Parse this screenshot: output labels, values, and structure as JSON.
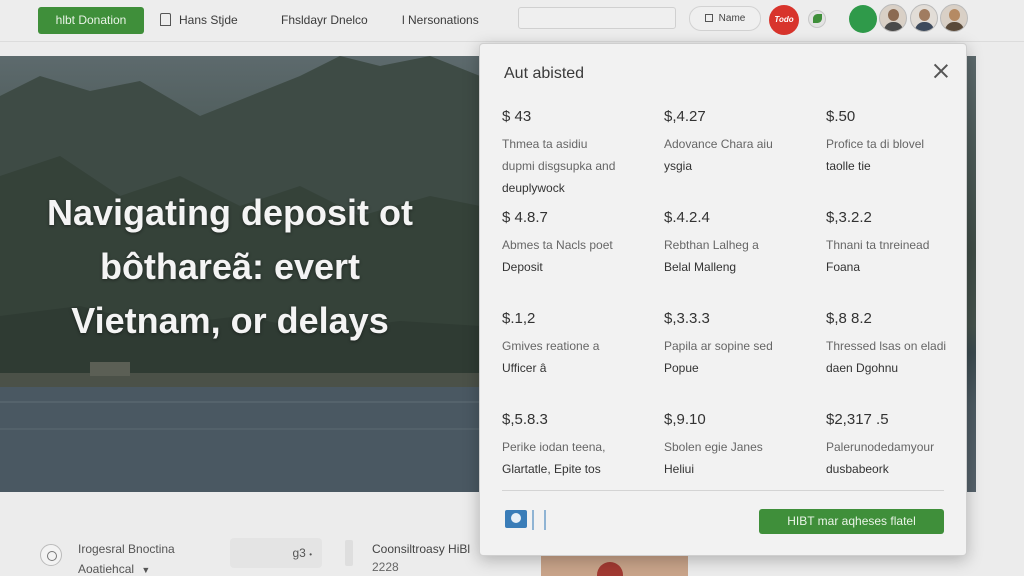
{
  "nav": {
    "cta_label": "hlbt Donation",
    "link1": "Hans Stjde",
    "link2": "Fhsldayr Dnelco",
    "link3": "l Nersonations",
    "search_placeholder": "",
    "name_button": "Name",
    "badge_red_text": "Todo",
    "accent_green": "#3f8f3a",
    "badge_red_color": "#d8342c"
  },
  "hero": {
    "title_line1": "Navigating deposit ot",
    "title_line2": "bôthareã: evert",
    "title_line3": "Vietnam, or delays"
  },
  "modal": {
    "title": "Aut abisted",
    "items": [
      {
        "price": "$ 43",
        "line1": "Thmea ta asidiu",
        "line2": "dupmi disgsupka and",
        "line3": "deuplywock"
      },
      {
        "price": "$,4.27",
        "line1": "Adovance Chara aiu",
        "line2": "ysgia",
        "line3": ""
      },
      {
        "price": "$.50",
        "line1": "Profice ta di blovel",
        "line2": "taolle tie",
        "line3": ""
      },
      {
        "price": "$ 4.8.7",
        "line1": "Abmes ta Nacls poet",
        "line2": "Deposit",
        "line3": ""
      },
      {
        "price": "$.4.2.4",
        "line1": "Rebthan Lalheg a",
        "line2": "Belal Malleng",
        "line3": ""
      },
      {
        "price": "$,3.2.2",
        "line1": "Thnani ta tnreinead",
        "line2": "Foana",
        "line3": ""
      },
      {
        "price": "$.1,2",
        "line1": "Gmives reatione a",
        "line2": "Ufficer â",
        "line3": ""
      },
      {
        "price": "$,3.3.3",
        "line1": "Papila ar sopine sed",
        "line2": "Popue",
        "line3": ""
      },
      {
        "price": "$,8 8.2",
        "line1": "Thressed lsas on eladi",
        "line2": "daen Dgohnu",
        "line3": ""
      },
      {
        "price": "$,5.8.3",
        "line1": "Perike iodan teena,",
        "line2": "Glartatle, Epite tos",
        "line3": ""
      },
      {
        "price": "$,9.10",
        "line1": "Sbolen egie Janes",
        "line2": "Heliui",
        "line3": ""
      },
      {
        "price": "$2,317 .5",
        "line1": "Palerunodedamyour",
        "line2": "dusbabeork",
        "line3": ""
      }
    ],
    "cta_label": "HIBT mar aqheses flatel"
  },
  "bottom": {
    "left_line1": "Irogesral Bnoctina",
    "left_line2": "Aoatiehcal",
    "pill_value": "g3",
    "center_line1": "Coonsiltroasy HiBl",
    "center_line2": "2228"
  }
}
